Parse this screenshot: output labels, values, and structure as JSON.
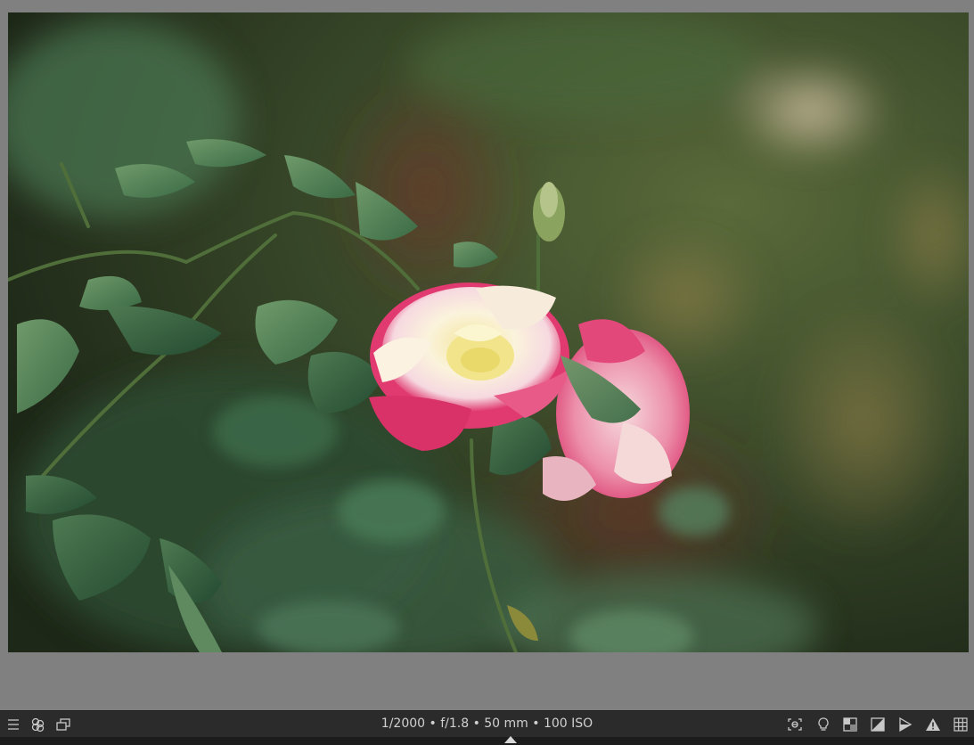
{
  "viewer": {
    "image_subject": "pink and cream rose in garden"
  },
  "toolbar": {
    "exif": "1/2000 • f/1.8 • 50 mm • 100 ISO",
    "left_icons": [
      "list-icon",
      "color-labels-icon",
      "duplicate-icon"
    ],
    "right_icons": [
      "focus-peaking-icon",
      "lightbulb-icon",
      "clipping-icon",
      "contrast-icon",
      "softproof-icon",
      "gamut-warning-icon",
      "grid-icon"
    ]
  },
  "colors": {
    "toolbar_bg": "#2b2b2b",
    "viewer_bg": "#808080",
    "icon_color": "#c8c8c8"
  }
}
